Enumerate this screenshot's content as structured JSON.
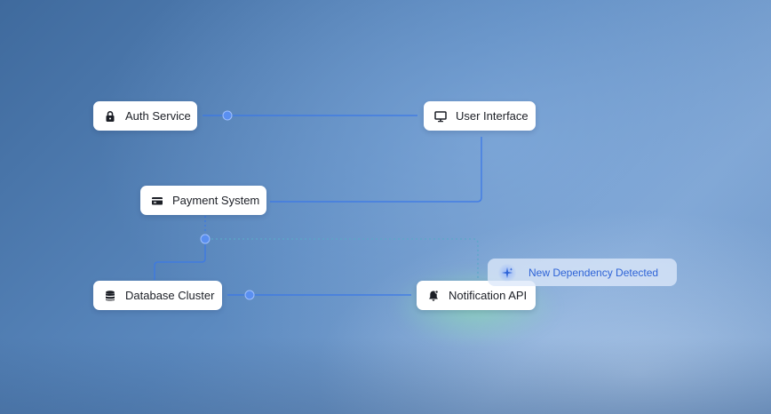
{
  "nodes": {
    "auth": {
      "label": "Auth Service",
      "icon": "lock-icon"
    },
    "ui": {
      "label": "User Interface",
      "icon": "monitor-icon"
    },
    "payment": {
      "label": "Payment System",
      "icon": "credit-card-icon"
    },
    "database": {
      "label": "Database Cluster",
      "icon": "database-icon"
    },
    "notification": {
      "label": "Notification API",
      "icon": "bell-icon"
    }
  },
  "badge": {
    "label": "New Dependency Detected",
    "icon": "sparkle-icon"
  },
  "colors": {
    "link": "#3b78e8",
    "link_alt": "#5aa8c8",
    "badge_text": "#2e63d6"
  }
}
